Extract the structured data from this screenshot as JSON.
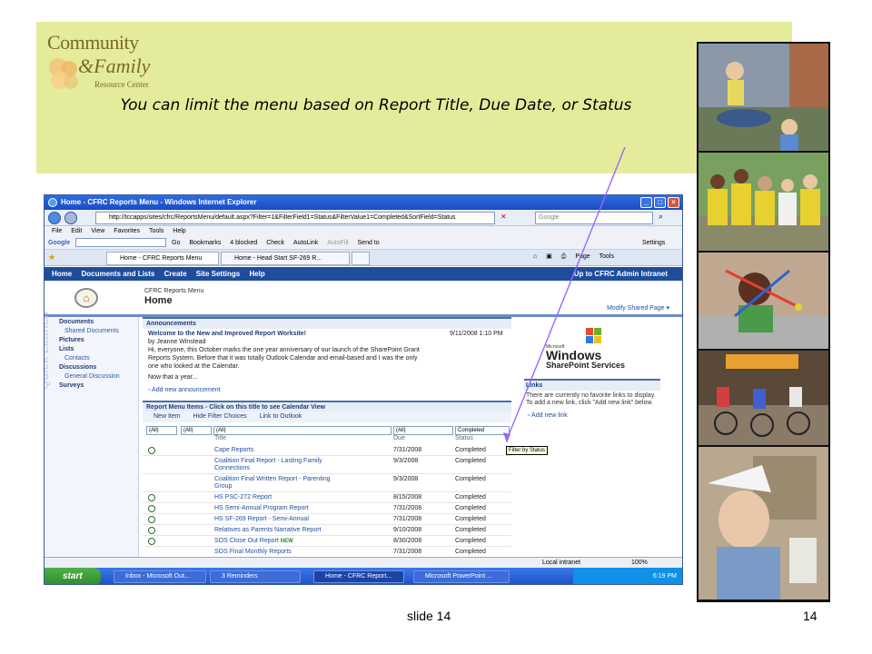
{
  "slide": {
    "logo": {
      "line1": "Community",
      "line2": "Family",
      "line3": "Resource Center"
    },
    "caption": "You can limit the menu based on Report Title, Due Date, or Status",
    "footer_left": "slide 14",
    "footer_right": "14",
    "band_color": "#e4ec9c",
    "arrow_color": "#9966ff"
  },
  "browser": {
    "title": "Home - CFRC Reports Menu - Windows Internet Explorer",
    "url": "http://tccapps/sites/cfrc/ReportsMenu/default.aspx?Filter=1&FilterField1=Status&FilterValue1=Completed&SortField=Status",
    "search_placeholder": "Google",
    "menu": [
      "File",
      "Edit",
      "View",
      "Favorites",
      "Tools",
      "Help"
    ],
    "googlebar": {
      "label": "Google",
      "go": "Go",
      "items": [
        "Bookmarks",
        "4 blocked",
        "Check",
        "AutoLink",
        "AutoFill",
        "Send to",
        "Settings"
      ]
    },
    "tabs": [
      "Home - CFRC Reports Menu",
      "Home - Head Start SF-269 R..."
    ],
    "tab_tools": [
      "Page",
      "Tools"
    ]
  },
  "sharepoint": {
    "topnav": [
      "Home",
      "Documents and Lists",
      "Create",
      "Site Settings",
      "Help"
    ],
    "topnav_right": "Up to CFRC Admin Intranet",
    "site_name": "CFRC Reports Menu",
    "page_name": "Home",
    "modify_page": "Modify Shared Page",
    "quicklaunch_watermark": "Quick Launch",
    "quicklaunch": [
      {
        "label": "Documents",
        "type": "head"
      },
      {
        "label": "Shared Documents",
        "type": "sub"
      },
      {
        "label": "Pictures",
        "type": "head"
      },
      {
        "label": "Lists",
        "type": "head"
      },
      {
        "label": "Contacts",
        "type": "sub"
      },
      {
        "label": "Discussions",
        "type": "head"
      },
      {
        "label": "General Discussion",
        "type": "sub"
      },
      {
        "label": "Surveys",
        "type": "head"
      }
    ],
    "announcements": {
      "header": "Announcements",
      "title": "Welcome to the New and Improved Report Worksite!",
      "date": "9/11/2008 1:10 PM",
      "author": "by Jeanne Winstead",
      "body1": "Hi, everyone, this October marks the one year anniversary of our launch of the SharePoint Grant",
      "body2": "Reports System. Before that it was totally Outlook Calendar and email-based and I was the only",
      "body3": "one who looked at the Calendar.",
      "more": "Now that a year...",
      "add": "Add new announcement"
    },
    "report_menu": {
      "header": "Report Menu Items - Click on this title to see Calendar View",
      "toolbar": [
        "New Item",
        "Hide Filter Choices",
        "Link to Outlook"
      ],
      "filters": [
        "(All)",
        "(All)",
        "(All)",
        "(All)",
        "Completed"
      ],
      "columns": [
        "Title",
        "Due",
        "Status"
      ],
      "tooltip": "Filter by Status",
      "rows": [
        {
          "title": "Cape Reports",
          "due": "7/31/2008",
          "status": "Completed"
        },
        {
          "title": "Coalition Final Report - Lasting Family",
          "title2": "Connections",
          "due": "9/3/2008",
          "status": "Completed"
        },
        {
          "title": "Coalition Final Written Report - Parenting",
          "title2": "Group",
          "due": "9/3/2008",
          "status": "Completed"
        },
        {
          "title": "HS PSC-272 Report",
          "due": "8/15/2008",
          "status": "Completed"
        },
        {
          "title": "HS Semi-Annual Program Report",
          "due": "7/31/2008",
          "status": "Completed"
        },
        {
          "title": "HS SF-269 Report - Semi-Annual",
          "due": "7/31/2008",
          "status": "Completed"
        },
        {
          "title": "Relatives as Parents Narrative Report",
          "due": "9/10/2008",
          "status": "Completed"
        },
        {
          "title": "SOS Close Out Report",
          "new": "NEW",
          "due": "8/30/2008",
          "status": "Completed"
        },
        {
          "title": "SOS Final Monthly Reports",
          "due": "7/31/2008",
          "status": "Completed"
        }
      ]
    },
    "windows_logo": {
      "w1": "Microsoft",
      "w2": "Windows",
      "w3": "SharePoint Services"
    },
    "links": {
      "header": "Links",
      "text": "There are currently no favorite links to display. To add a new link, click \"Add new link\" below.",
      "add": "Add new link"
    }
  },
  "status_bar": {
    "zone": "Local intranet",
    "zoom": "100%"
  },
  "taskbar": {
    "start": "start",
    "tasks": [
      "Inbox - Microsoft Out...",
      "3 Reminders",
      "Home - CFRC Report...",
      "Microsoft PowerPoint ..."
    ],
    "clock": "6:19 PM"
  }
}
